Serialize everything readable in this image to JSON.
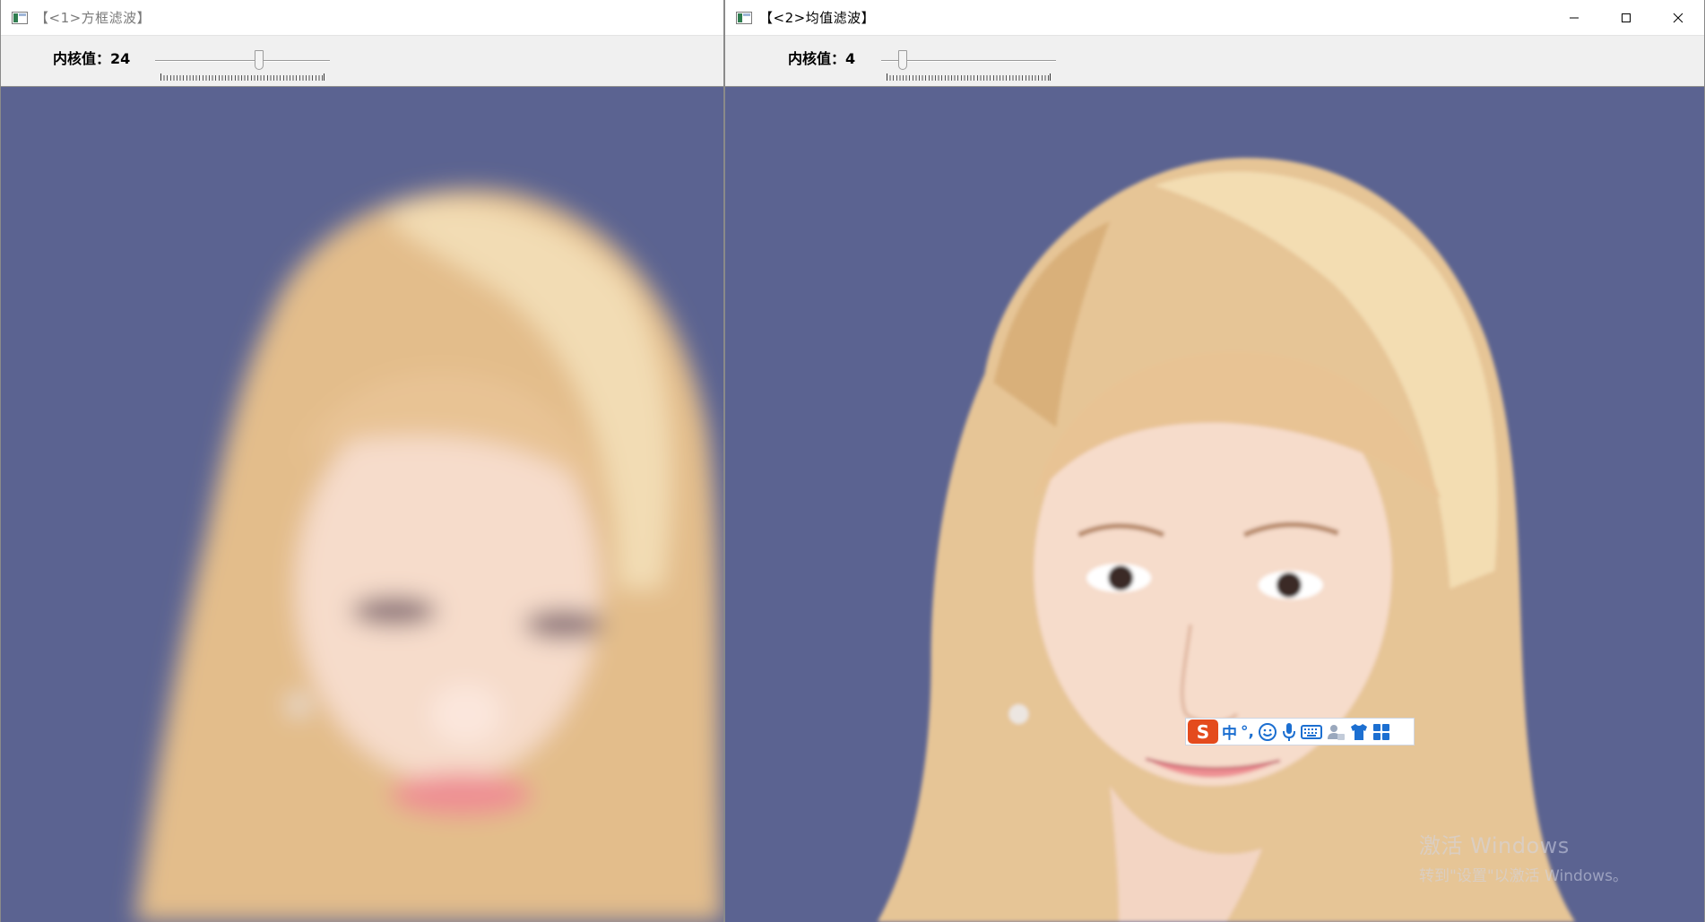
{
  "colors": {
    "background_blue": "#5b6391",
    "hair": "#e6c596",
    "skin": "#f6dccb",
    "lips": "#ee8f93",
    "ime_accent": "#1c6fd1",
    "ime_logo": "#e44b1d"
  },
  "windows": [
    {
      "title": "【<1>方框滤波】",
      "icon": "opencv-window-icon",
      "active": false,
      "trackbar": {
        "label": "内核值",
        "separator": "：",
        "value_text": "24",
        "value": 24,
        "max": 40
      },
      "image": {
        "content": "blurred-portrait",
        "blur_level": "strong"
      }
    },
    {
      "title": "【<2>均值滤波】",
      "icon": "opencv-window-icon",
      "active": true,
      "caption_buttons": [
        "minimize-icon",
        "maximize-icon",
        "close-icon"
      ],
      "trackbar": {
        "label": "内核值",
        "separator": "：",
        "value_text": "4",
        "value": 4,
        "max": 40
      },
      "image": {
        "content": "slightly-blurred-portrait",
        "blur_level": "light"
      }
    }
  ],
  "ime_toolbar": {
    "logo": "S",
    "mode": "中",
    "punctuation": "°,",
    "icons": [
      "emoji-icon",
      "microphone-icon",
      "keyboard-icon",
      "user-icon",
      "skin-icon",
      "grid-icon"
    ]
  },
  "watermark": {
    "title": "激活 Windows",
    "subtitle": "转到\"设置\"以激活 Windows。"
  }
}
